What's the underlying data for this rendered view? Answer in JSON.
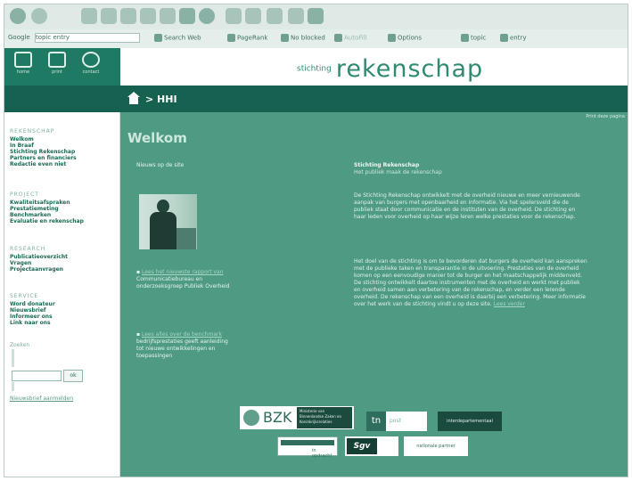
{
  "browser": {
    "toolbar2": {
      "search_label": "Google",
      "search_value": "topic entry",
      "search_web": "Search Web",
      "pagerank": "PageRank",
      "blocked": "No blocked",
      "autofill": "AutoFill",
      "options": "Options",
      "item1": "topic",
      "item2": "entry"
    }
  },
  "header": {
    "icons": [
      {
        "label": "home"
      },
      {
        "label": "print"
      },
      {
        "label": "contact"
      }
    ],
    "brand_small": "stichting",
    "brand_big": "rekenschap"
  },
  "navbar": {
    "breadcrumb": "> HHI"
  },
  "sidebar": {
    "sections": [
      {
        "title": "REKENSCHAP",
        "links": [
          "Welkom",
          "In Braaf",
          "Stichting Rekenschap",
          "Partners en financiers",
          "Redactie even niet"
        ]
      },
      {
        "title": "PROJECT",
        "links": [
          "Kwaliteitsafspraken",
          "Prestatiemeting",
          "Benchmarken",
          "Evaluatie en rekenschap"
        ]
      },
      {
        "title": "RESEARCH",
        "links": [
          "Publicatieoverzicht",
          "Vragen",
          "Projectaanvragen"
        ]
      },
      {
        "title": "SERVICE",
        "links": [
          "Word donateur",
          "Nieuwsbrief",
          "Informeer ons",
          "Link naar ons"
        ]
      }
    ],
    "search_label": "Zoeken",
    "search_button": "ok",
    "bottom_link": "Nieuwsbrief aanmelden"
  },
  "main": {
    "top_right": "Print deze pagina",
    "title": "Welkom",
    "left_caption": "Nieuws op de site",
    "bullets": [
      {
        "link": "Lees het nieuwste rapport van",
        "text": "Communicatiebureau en onderzoeksgroep Publiek Overheid"
      },
      {
        "link": "Lees alles over de benchmark",
        "text": "bedrijfsprestaties geeft aanleiding tot nieuwe ontwikkelingen en toepassingen"
      }
    ],
    "right_title": "Stichting Rekenschap",
    "right_subtitle": "Het publiek maak de rekenschap",
    "paragraph1": "De Stichting Rekenschap ontwikkelt met de overheid nieuwe en meer vernieuwende aanpak van burgers met openbaarheid en informatie. Via het spelersveld die de publiek staat door communicatie en de instituten van de overheid. De stichting en haar leden voor overheid op haar wijze leren welke prestaties voor de rekenschap.",
    "paragraph2": "Het doel van de stichting is om te bevorderen dat burgers de overheid kan aanspreken met de publieke taken en transparantie in de uitvoering. Prestaties van de overheid komen op een eenvoudige manier tot de burger en het maatschappelijk middenveld. De stichting ontwikkelt daartoe instrumenten met de overheid en werkt met publiek en overheid samen aan verbetering van de rekenschap, en verder een lerende overheid. De rekenschap van een overheid is daarbij een verbetering. Meer informatie over het werk van de stichting vindt u op deze site.",
    "para_link": "Lees verder"
  },
  "partners": {
    "bzk_text": "BZK",
    "bzk_sub": "Ministerie van Binnenlandse Zaken en Koninkrijksrelaties",
    "tnt_mark": "tn",
    "tnt_rest": "post",
    "logo3": "interdepartementaal",
    "logo4": "in opdracht",
    "logo5": "Sgv",
    "logo6": "nationale partner"
  }
}
